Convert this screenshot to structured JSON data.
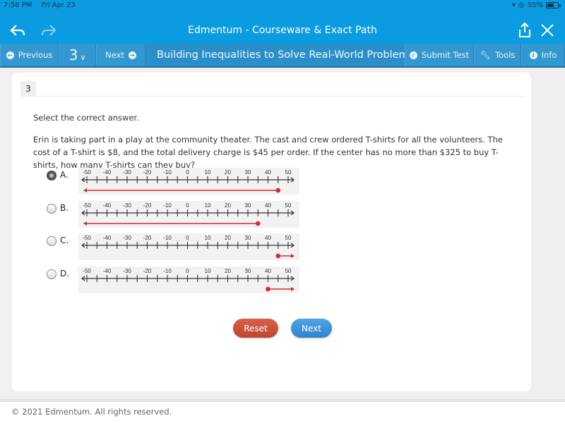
{
  "status_bar": {
    "time": "7:56 PM",
    "date": "Fri Apr 23",
    "battery": "55%"
  },
  "header": {
    "title": "Edmentum - Courseware & Exact Path"
  },
  "toolbar": {
    "previous_label": "Previous",
    "question_number": "3",
    "next_label": "Next",
    "lesson_title": "Building Inequalities to Solve Real-World Problems:",
    "submit_label": "Submit Test",
    "tools_label": "Tools",
    "info_label": "Info"
  },
  "question": {
    "number": "3",
    "instruction": "Select the correct answer.",
    "prompt": "Erin is taking part in a play at the community theater. The cast and crew ordered T-shirts for all the volunteers. The cost of a T-shirt is $8, and the total delivery charge is $45 per order. If the center has no more than $325 to buy T-shirts, how many T-shirts can they buy?",
    "selected": "A",
    "number_line": {
      "min": -50,
      "max": 50,
      "major_step": 10,
      "minor_step": 5,
      "tick_labels": [
        "-50",
        "-40",
        "-30",
        "-20",
        "-10",
        "0",
        "10",
        "20",
        "30",
        "40",
        "50"
      ]
    },
    "options": [
      {
        "letter": "A.",
        "endpoint": 45,
        "direction": "left",
        "closed": true,
        "selected": true
      },
      {
        "letter": "B.",
        "endpoint": 35,
        "direction": "left",
        "closed": true,
        "selected": false
      },
      {
        "letter": "C.",
        "endpoint": 45,
        "direction": "right",
        "closed": true,
        "selected": false
      },
      {
        "letter": "D.",
        "endpoint": 40,
        "direction": "right",
        "closed": true,
        "selected": false
      }
    ]
  },
  "buttons": {
    "reset": "Reset",
    "next": "Next"
  },
  "colors": {
    "header": "#0a9be0",
    "toolbar": "#2a8fc8",
    "ray": "#d42b2b",
    "reset": "#c94f3a",
    "next": "#3a91d8"
  },
  "footer": {
    "copyright": "© 2021 Edmentum. All rights reserved."
  }
}
